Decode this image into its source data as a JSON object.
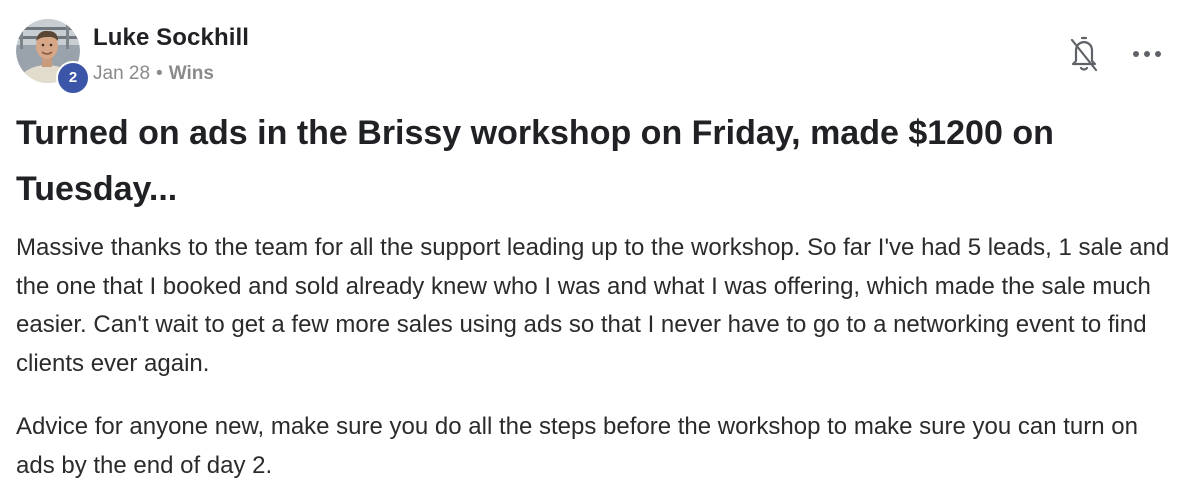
{
  "post": {
    "author": {
      "name": "Luke Sockhill",
      "level": "2"
    },
    "meta": {
      "date": "Jan 28",
      "separator": "•",
      "category": "Wins"
    },
    "actions": {
      "bell_icon": "bell-off-icon",
      "more_icon": "more-horizontal-icon"
    },
    "title": "Turned on ads in the Brissy workshop on Friday, made $1200 on Tuesday...",
    "body": [
      "Massive thanks to the team for all the support leading up to the workshop. So far I've had 5 leads, 1 sale and the one that I booked and sold already knew who I was and what I was offering, which made the sale much easier. Can't wait to get a few more sales using ads so that I never have to go to a networking event to find clients ever again.",
      "Advice for anyone new, make sure you do all the steps before the workshop to make sure you can turn on ads by the end of day 2."
    ]
  },
  "colors": {
    "badge": "#3b55a8",
    "meta_text": "#8a8a8a",
    "title_text": "#202124",
    "body_text": "#2b2b2b"
  }
}
